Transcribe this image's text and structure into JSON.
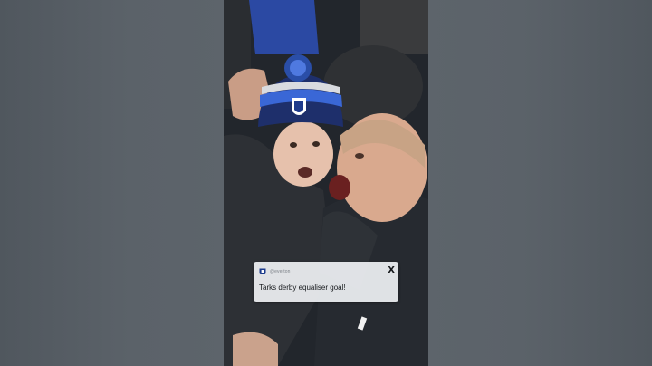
{
  "post": {
    "handle": "@everton",
    "text": "Tarks derby equaliser goal!",
    "platform_icon": "x-logo",
    "avatar_icon": "everton-crest-icon"
  },
  "colors": {
    "background": "#565d64",
    "card_background": "#eef0f3",
    "text": "#14171a",
    "handle_text": "#7b8087",
    "everton_blue": "#1b3a8c"
  }
}
